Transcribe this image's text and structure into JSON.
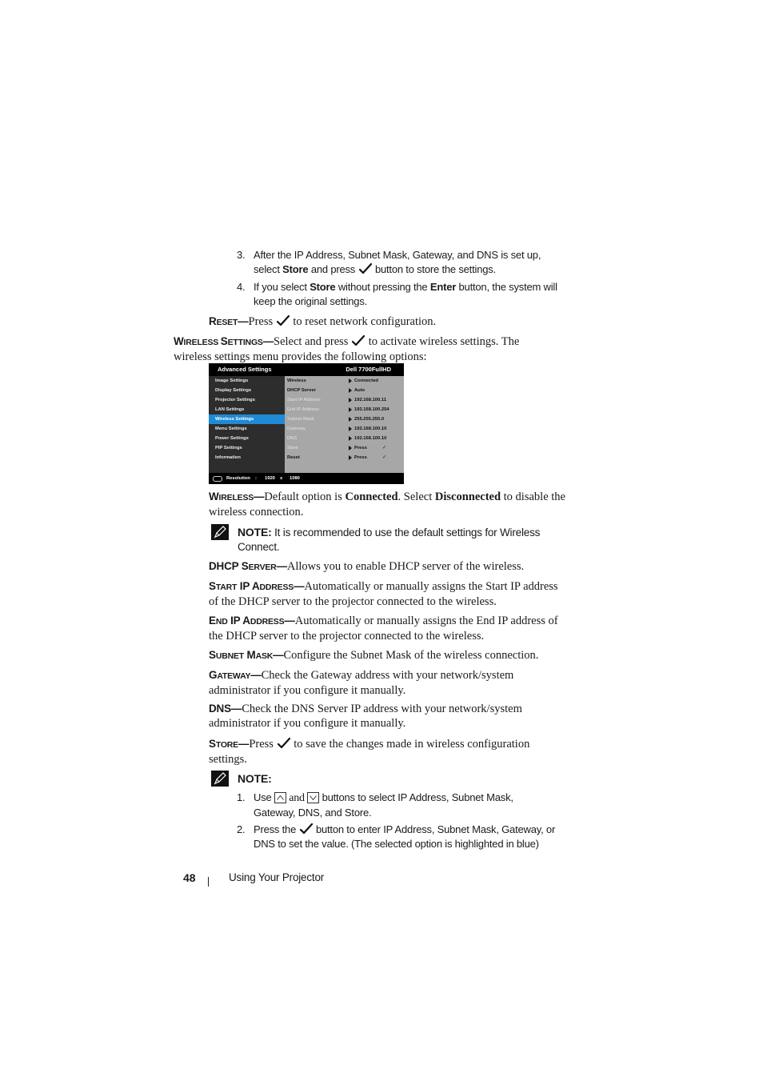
{
  "steps_top": [
    {
      "num": "3.",
      "parts": [
        "After the IP Address, Subnet Mask, Gateway, and DNS is set up, select ",
        "Store",
        " and press ",
        " button to store the settings."
      ]
    },
    {
      "num": "4.",
      "parts": [
        "If you select ",
        "Store",
        " without pressing the ",
        "Enter",
        " button, the system will keep the original settings."
      ]
    }
  ],
  "reset": {
    "term_first": "R",
    "term_rest": "ESET",
    "dash": "—",
    "before": "Press ",
    "after": " to reset network configuration."
  },
  "wireless_settings": {
    "term_first1": "W",
    "term_rest1": "IRELESS ",
    "term_first2": "S",
    "term_rest2": "ETTINGS",
    "dash": "—",
    "before": "Select and press ",
    "after": " to activate wireless settings. The wireless settings menu provides the following options:"
  },
  "osd": {
    "title": "Advanced Settings",
    "model": "Dell 7700FullHD",
    "left_items": [
      "Image Settings",
      "Display Settings",
      "Projector Settings",
      "LAN Settings",
      "Wireless Settings",
      "Menu Settings",
      "Power Settings",
      "PIP Settings",
      "Information"
    ],
    "selected_left": "Wireless Settings",
    "right_items": [
      {
        "label": "Wireless",
        "value": "Connected",
        "active": true,
        "tick": ""
      },
      {
        "label": "DHCP Server",
        "value": "Auto",
        "active": true,
        "tick": ""
      },
      {
        "label": "Start IP Address",
        "value": "192.168.100.11",
        "active": false,
        "tick": ""
      },
      {
        "label": "End IP Address",
        "value": "192.168.100.254",
        "active": false,
        "tick": ""
      },
      {
        "label": "Subnet Mask",
        "value": "255.255.255.0",
        "active": false,
        "tick": ""
      },
      {
        "label": "Gateway",
        "value": "192.168.100.10",
        "active": false,
        "tick": ""
      },
      {
        "label": "DNS",
        "value": "192.168.100.10",
        "active": false,
        "tick": ""
      },
      {
        "label": "Store",
        "value": "Press",
        "active": false,
        "tick": "✓"
      },
      {
        "label": "Reset",
        "value": "Press",
        "active": true,
        "tick": "✓"
      }
    ],
    "footer": {
      "label": "Resolution",
      "sep": ":",
      "width": "1920",
      "x": "x",
      "height": "1080"
    },
    "colors": {
      "header_bg": "#000000",
      "left_bg": "#2d2d2d",
      "right_bg": "#a7a7a7",
      "selected_bg": "#1f8ad6"
    }
  },
  "wireless": {
    "term_first": "W",
    "term_rest": "IRELESS",
    "dash": "—",
    "t1": "Default option is ",
    "b1": "Connected",
    "t2": ". Select ",
    "b2": "Disconnected",
    "t3": " to disable the wireless connection."
  },
  "note1": {
    "label": "NOTE:",
    "text": " It is recommended to use the default settings for Wireless Connect."
  },
  "dhcp": {
    "term_a": "DHCP S",
    "term_b": "ERVER",
    "dash": "—",
    "text": "Allows you to enable DHCP server of the wireless."
  },
  "start_ip": {
    "term_a": "S",
    "term_b": "TART",
    "term_c": " IP A",
    "term_d": "DDRESS",
    "dash": "—",
    "text": "Automatically or manually assigns the Start IP address of the DHCP server to the projector connected to the wireless."
  },
  "end_ip": {
    "term_a": "E",
    "term_b": "ND",
    "term_c": " IP A",
    "term_d": "DDRESS",
    "dash": "—",
    "text": "Automatically or manually assigns the End IP address of the DHCP server to the projector connected to the wireless."
  },
  "subnet": {
    "term_a": "S",
    "term_b": "UBNET",
    "term_c": " M",
    "term_d": "ASK",
    "dash": "—",
    "text": "Configure the Subnet Mask of the wireless connection."
  },
  "gateway": {
    "term_a": "G",
    "term_b": "ATEWAY",
    "dash": "—",
    "text": "Check the Gateway address with your network/system administrator if you configure it manually."
  },
  "dns": {
    "term": "DNS",
    "dash": "—",
    "text": "Check the DNS Server IP address with your network/system administrator if you configure it manually."
  },
  "store": {
    "term_a": "S",
    "term_b": "TORE",
    "dash": "—",
    "before": "Press ",
    "after": " to save the changes made in wireless configuration settings."
  },
  "note2": {
    "label": "NOTE:",
    "items": [
      {
        "num": "1.",
        "t1": "Use ",
        "and": " and ",
        "t2": " buttons to select IP Address, Subnet Mask, Gateway, DNS, and Store."
      },
      {
        "num": "2.",
        "t1": "Press the ",
        "t2": " button to enter IP Address, Subnet Mask, Gateway, or DNS to set the value. (The selected option is highlighted in blue)"
      }
    ]
  },
  "footer": {
    "page_number": "48",
    "section_title": "Using Your Projector"
  },
  "icons": {
    "check": "check-icon",
    "note": "pencil-note-icon",
    "up": "up-arrow-button-icon",
    "down": "down-arrow-button-icon"
  }
}
